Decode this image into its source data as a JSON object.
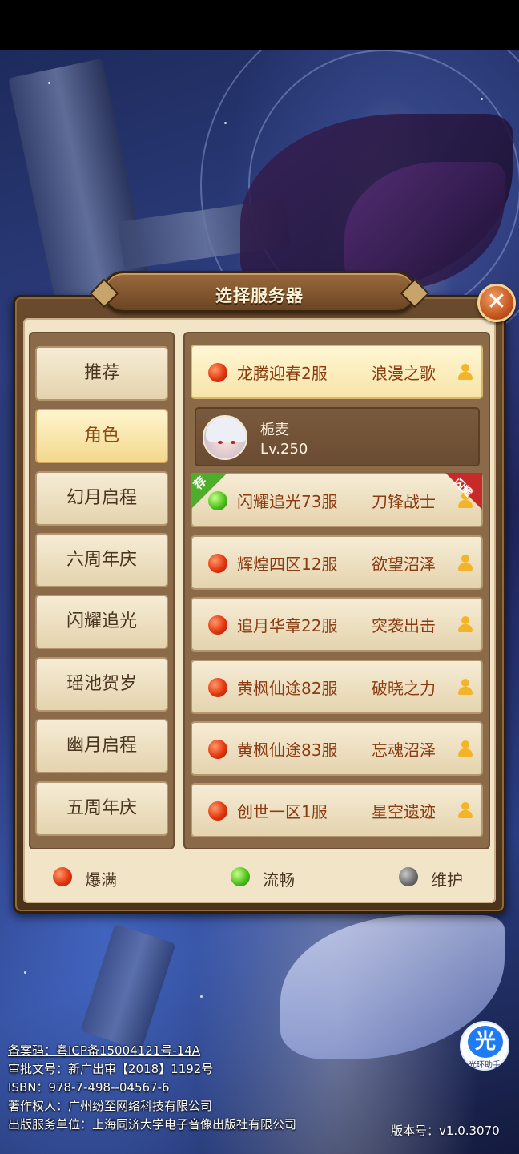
{
  "dialog": {
    "title": "选择服务器",
    "close_symbol": "✕"
  },
  "tabs": [
    {
      "label": "推荐",
      "active": false
    },
    {
      "label": "角色",
      "active": true
    },
    {
      "label": "幻月启程",
      "active": false
    },
    {
      "label": "六周年庆",
      "active": false
    },
    {
      "label": "闪耀追光",
      "active": false
    },
    {
      "label": "瑶池贺岁",
      "active": false
    },
    {
      "label": "幽月启程",
      "active": false
    },
    {
      "label": "五周年庆",
      "active": false
    }
  ],
  "servers": [
    {
      "name": "龙腾迎春2服",
      "role": "浪漫之歌",
      "status": "red"
    },
    {
      "name": "闪耀追光73服",
      "role": "刀锋战士",
      "status": "green",
      "badge_left": "荐",
      "badge_right": "闪耀"
    },
    {
      "name": "辉煌四区12服",
      "role": "欲望沼泽",
      "status": "red"
    },
    {
      "name": "追月华章22服",
      "role": "突袭出击",
      "status": "red"
    },
    {
      "name": "黄枫仙途82服",
      "role": "破晓之力",
      "status": "red"
    },
    {
      "name": "黄枫仙途83服",
      "role": "忘魂沼泽",
      "status": "red"
    },
    {
      "name": "创世一区1服",
      "role": "星空遗迹",
      "status": "red"
    }
  ],
  "character": {
    "name": "栀麦",
    "level": "Lv.250"
  },
  "legend": [
    {
      "label": "爆满",
      "color": "red"
    },
    {
      "label": "流畅",
      "color": "green"
    },
    {
      "label": "维护",
      "color": "gray"
    }
  ],
  "footer": {
    "icp": "备案码：粤ICP备15004121号-14A",
    "approval": "审批文号：新广出审【2018】1192号",
    "isbn": "ISBN：978-7-498--04567-6",
    "copyright": "著作权人：广州纷至网络科技有限公司",
    "publisher": "出版服务单位：上海同济大学电子音像出版社有限公司",
    "version": "版本号：v1.0.3070"
  },
  "helper": {
    "glyph": "光",
    "caption": "光环助手"
  },
  "colors": {
    "status_red": "#e4360f",
    "status_green": "#4ec21d",
    "status_gray": "#6f6f6f",
    "text_brown": "#8a3c10"
  }
}
